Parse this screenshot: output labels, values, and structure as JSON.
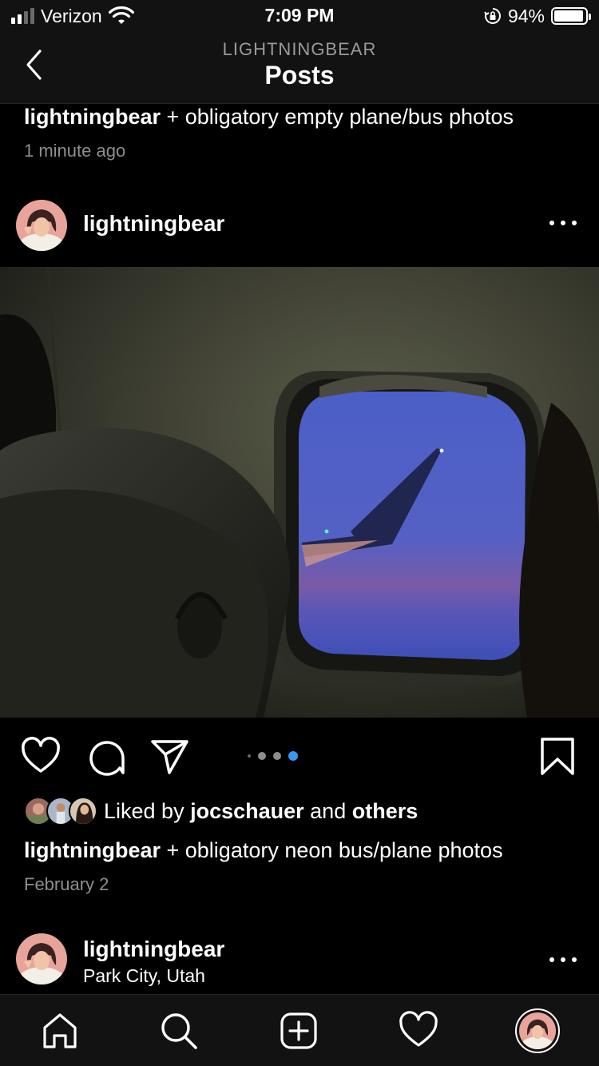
{
  "status_bar": {
    "carrier": "Verizon",
    "time": "7:09 PM",
    "battery_percent": "94%",
    "battery_level": 0.94,
    "signal_bars": 2
  },
  "nav": {
    "subtitle": "LIGHTNINGBEAR",
    "title": "Posts"
  },
  "previous_post": {
    "username": "lightningbear",
    "caption": " + obligatory empty plane/bus photos",
    "timestamp": "1 minute ago"
  },
  "post": {
    "username": "lightningbear",
    "carousel": {
      "count": 4,
      "active_index": 3
    },
    "liked_by_prefix": "Liked by ",
    "liked_by_user": "jocschauer",
    "liked_by_and": " and ",
    "liked_by_others": "others",
    "caption_user": "lightningbear",
    "caption": " + obligatory neon bus/plane photos",
    "date": "February 2"
  },
  "next_post": {
    "username": "lightningbear",
    "location": "Park City, Utah"
  },
  "icons": {
    "back": "chevron-left-icon",
    "more": "more-horizontal-icon",
    "like": "heart-icon",
    "comment": "comment-icon",
    "share": "send-icon",
    "save": "bookmark-icon",
    "tabs": [
      "home-icon",
      "search-icon",
      "add-post-icon",
      "activity-heart-icon",
      "profile-avatar"
    ]
  },
  "colors": {
    "background": "#000000",
    "bar_background": "#121212",
    "secondary_text": "#8e8e8e",
    "carousel_active": "#3897f0"
  }
}
